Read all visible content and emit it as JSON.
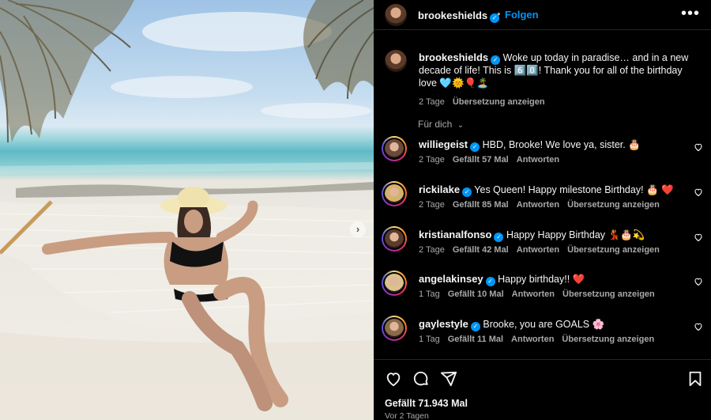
{
  "post": {
    "username": "brookeshields",
    "follow_label": "Folgen",
    "caption": "Woke up today in paradise… and in a new decade of life! This is 6️⃣0️⃣! Thank you for all of the birthday love 🩵🌞🎈🏝️",
    "caption_time": "2 Tage",
    "caption_translate": "Übersetzung anzeigen",
    "likes": "Gefällt 71.943 Mal",
    "date": "Vor 2 Tagen"
  },
  "sort_label": "Für dich",
  "comments": [
    {
      "username": "williegeist",
      "text": "HBD, Brooke! We love ya, sister. 🎂",
      "time": "2 Tage",
      "likes": "Gefällt 57 Mal",
      "reply": "Antworten",
      "translate": ""
    },
    {
      "username": "rickilake",
      "text": "Yes Queen! Happy milestone Birthday! 🎂 ❤️",
      "time": "2 Tage",
      "likes": "Gefällt 85 Mal",
      "reply": "Antworten",
      "translate": "Übersetzung anzeigen"
    },
    {
      "username": "kristianalfonso",
      "text": "Happy Happy Birthday 💃🎂💫",
      "time": "2 Tage",
      "likes": "Gefällt 42 Mal",
      "reply": "Antworten",
      "translate": "Übersetzung anzeigen"
    },
    {
      "username": "angelakinsey",
      "text": "Happy birthday!! ❤️",
      "time": "1 Tag",
      "likes": "Gefällt 10 Mal",
      "reply": "Antworten",
      "translate": "Übersetzung anzeigen"
    },
    {
      "username": "gaylestyle",
      "text": "Brooke, you are GOALS 🌸",
      "time": "1 Tag",
      "likes": "Gefällt 11 Mal",
      "reply": "Antworten",
      "translate": "Übersetzung anzeigen"
    }
  ],
  "colors": {
    "accent": "#0095f6",
    "background": "#000000",
    "muted": "#a8a8a8"
  }
}
